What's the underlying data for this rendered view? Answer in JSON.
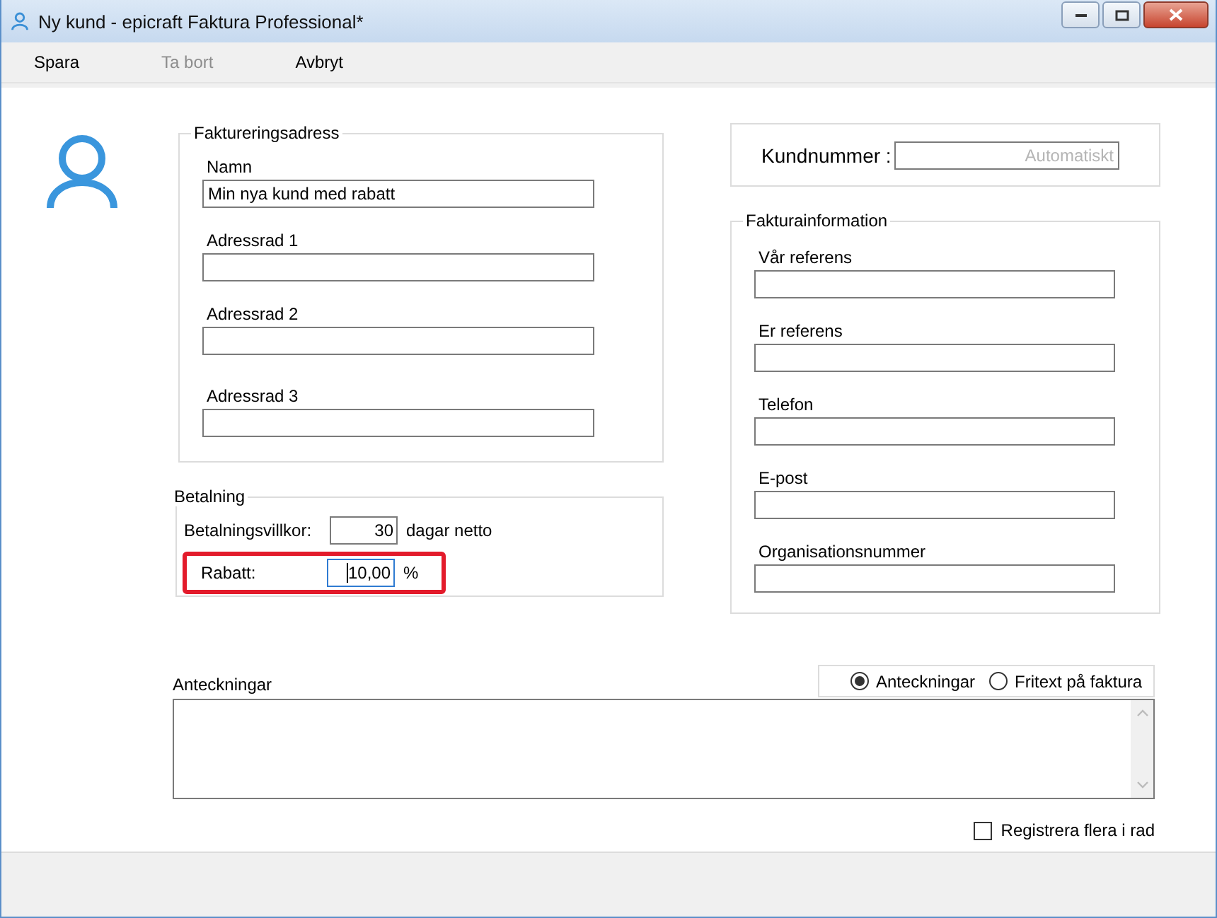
{
  "window": {
    "title": "Ny kund - epicraft Faktura Professional*"
  },
  "menu": [
    {
      "label": "Spara",
      "disabled": false
    },
    {
      "label": "Ta bort",
      "disabled": true
    },
    {
      "label": "Avbryt",
      "disabled": false
    }
  ],
  "billing_address": {
    "title": "Faktureringsadress",
    "fields": [
      {
        "label": "Namn",
        "value": "Min nya kund med rabatt"
      },
      {
        "label": "Adressrad 1"
      },
      {
        "label": "Adressrad 2"
      },
      {
        "label": "Adressrad 3"
      }
    ]
  },
  "payment": {
    "title": "Betalning",
    "rows": [
      {
        "label": "Betalningsvillkor:",
        "value": "30",
        "unit": "dagar netto",
        "focused": false,
        "highlighted": false
      },
      {
        "label": "Rabatt:",
        "value": "10,00",
        "unit": "%",
        "focused": true,
        "highlighted": true
      }
    ]
  },
  "customer_number": {
    "label": "Kundnummer :",
    "placeholder": "Automatiskt"
  },
  "invoice_info": {
    "title": "Fakturainformation",
    "fields": [
      {
        "label": "Vår referens"
      },
      {
        "label": "Er referens"
      },
      {
        "label": "Telefon"
      },
      {
        "label": "E-post"
      },
      {
        "label": "Organisationsnummer"
      }
    ]
  },
  "notes": {
    "label": "Anteckningar",
    "options": [
      {
        "label": "Anteckningar",
        "selected": true
      },
      {
        "label": "Fritext på faktura",
        "selected": false
      }
    ]
  },
  "register_multiple": {
    "label": "Registrera flera i rad",
    "checked": false
  }
}
